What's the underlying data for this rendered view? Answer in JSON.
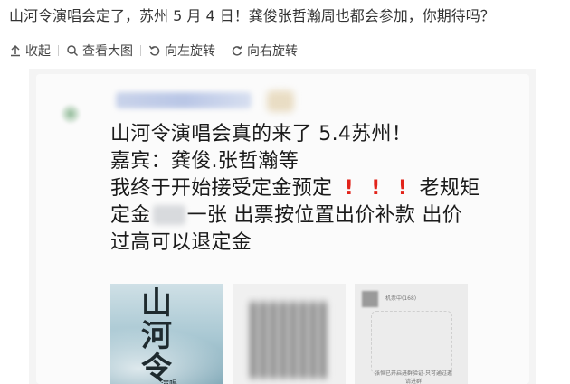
{
  "headline": "山河令演唱会定了，苏州 5 月 4 日！龚俊张哲瀚周也都会参加，你期待吗？",
  "toolbar": {
    "collapse": "收起",
    "view_large": "查看大图",
    "rotate_left": "向左旋转",
    "rotate_right": "向右旋转"
  },
  "icons": {
    "collapse": "arrow-up-icon",
    "view_large": "magnifier-icon",
    "rotate_left": "rotate-left-icon",
    "rotate_right": "rotate-right-icon"
  },
  "post": {
    "line1": "山河令演唱会真的来了 5.4苏州！",
    "line2": "嘉宾：龚俊.张哲瀚等",
    "line3_a": "我终于开始接受定金预定",
    "exclaims": [
      "!",
      "!",
      "!"
    ],
    "line3_b": "老规矩",
    "line4_a": "定金",
    "line4_b": "一张 出票按位置出价补款 出价",
    "line5": "过高可以退定金"
  },
  "thumbs": {
    "poster_title": "山河令",
    "poster_sub": "演唱",
    "right_tiny": "机票中(168)",
    "right_note": "张恒已开启进群验证 只可通过邀请进群"
  },
  "colors": {
    "exclaim": "#e2231a",
    "text": "#1a1a1a"
  }
}
